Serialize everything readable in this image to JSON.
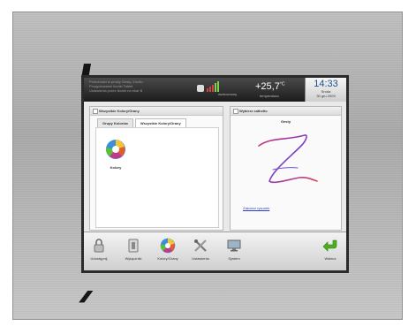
{
  "header": {
    "messages": [
      "Przechodzi w prosty Gesty, Zrodlo",
      "Przygotowanie ikonki Tablet",
      "Ustawienia przez Ikonki na ekar B"
    ],
    "signal_label": "wzmocnony",
    "temperature": "+25,7",
    "temperature_unit": "°C",
    "temperature_label": "temperatura",
    "time": "14:33",
    "day": "Sroda",
    "date": "30 gru 2009"
  },
  "left_panel": {
    "title": "Wszystkie Kolory/Grany",
    "tabs": [
      "Grupy Kolorów",
      "Wszystkie Kolory/Grany"
    ],
    "active_tab": 1,
    "item_label": "Kolory"
  },
  "right_panel": {
    "title": "Wybierz cathetlo",
    "subtitle": "Gesty",
    "link": "Zakoncz rysunek"
  },
  "toolbar": {
    "buttons": [
      "Udostępnij",
      "Wyłączniki",
      "Kolory/Grany",
      "Ustawienia",
      "System"
    ],
    "back_label": "Wstecz"
  },
  "colors": {
    "accent": "#1c4f8a",
    "link": "#2a3fd0",
    "confirm": "#4caf1c"
  }
}
